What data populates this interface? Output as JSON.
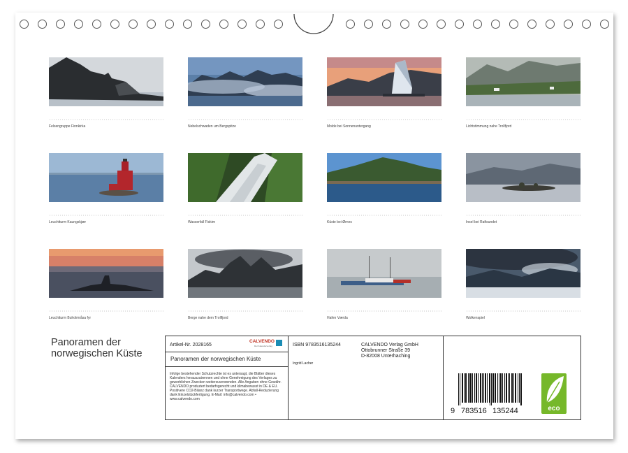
{
  "photos": [
    {
      "caption": "Felsengruppe Finnkirka"
    },
    {
      "caption": "Nebelschwaden um Bergspitze"
    },
    {
      "caption": "Molde bei Sonnenuntergang"
    },
    {
      "caption": "Lichtstimmung nahe Trollfjord"
    },
    {
      "caption": "Leuchtturm Kaungskjær"
    },
    {
      "caption": "Wasserfall Fiskim"
    },
    {
      "caption": "Küste bei Ørnes"
    },
    {
      "caption": "Insel bei Raftsundet"
    },
    {
      "caption": "Leuchtturm Buholmråsa fyr"
    },
    {
      "caption": "Berge nahe dem Trollfjord"
    },
    {
      "caption": "Hafen Værda"
    },
    {
      "caption": "Wolkenspiel"
    }
  ],
  "title_line1": "Panoramen der",
  "title_line2": "norwegischen Küste",
  "info": {
    "article": "Artikel-Nr. 2028165",
    "publisher_logo": "CALVENDO",
    "publisher_logo_sub": "Der Kalenderverlag",
    "product_title": "Panoramen der norwegischen Küste",
    "legal_text": "Infolge bestehender Schutzrechte ist es untersagt, die Blätter dieses Kalenders herauszutrennen und ohne Genehmigung des Verlages zu gewerblichen Zwecken weiterzuverwenden. Alle Angaben ohne Gewähr. CALVENDO produziert bedarfsgerecht und klimabewusst in DE & EU. Positivere CO2-Bilanz dank kurzer Transportwege. Abfall-Reduzierung dank Einzelstückfertigung. E-Mail: info@calvendo.com • www.calvendo.com",
    "isbn": "ISBN 9783516135244",
    "author": "Ingrid Lacher",
    "publisher_name": "CALVENDO Verlag GmbH",
    "publisher_street": "Ottobrunner Straße 39",
    "publisher_city": "D-82008 Unterhaching",
    "barcode_first": "9",
    "barcode_mid": "783516",
    "barcode_last": "135244",
    "eco_label": "eco"
  }
}
